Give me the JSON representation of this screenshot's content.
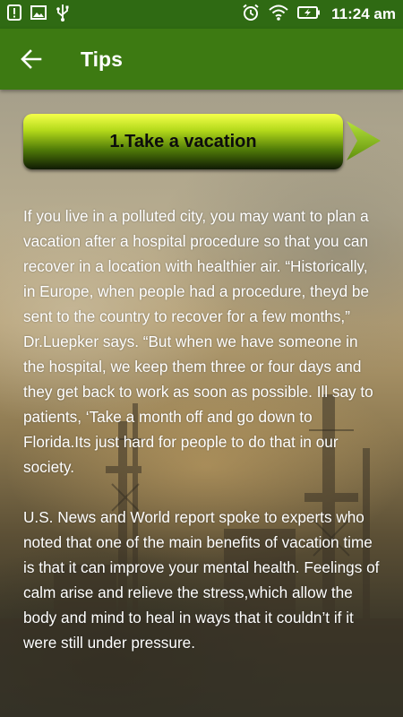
{
  "status_bar": {
    "time": "11:24 am",
    "left_icons": [
      "alert-icon",
      "image-icon",
      "usb-icon"
    ],
    "right_icons": [
      "alarm-icon",
      "wifi-icon",
      "battery-charging-icon"
    ]
  },
  "app_bar": {
    "title": "Tips",
    "background": "#3d7a12"
  },
  "tip": {
    "title": "1.Take a vacation",
    "paragraphs": [
      "If you live in a polluted city, you may want to plan a vacation after a hospital procedure so that you can recover in a location with healthier air. “Historically, in Europe, when people had a procedure, theyd be sent to the country to recover for a few months,” Dr.Luepker says. “But when we have someone in the hospital, we keep them three or four days and they get back to work as soon as possible. Ill say to patients, ‘Take a month off and go down to Florida.Its just hard for people to do that in our society.",
      "U.S. News and World report spoke to experts who noted that one of the main benefits of vacation time is that it can improve your mental health. Feelings of calm arise and relieve the stress,which allow the body and mind to heal in ways that it couldn’t if it were still under pressure."
    ]
  },
  "colors": {
    "status_bar": "#2f6a13",
    "accent": "#8fc21c"
  }
}
